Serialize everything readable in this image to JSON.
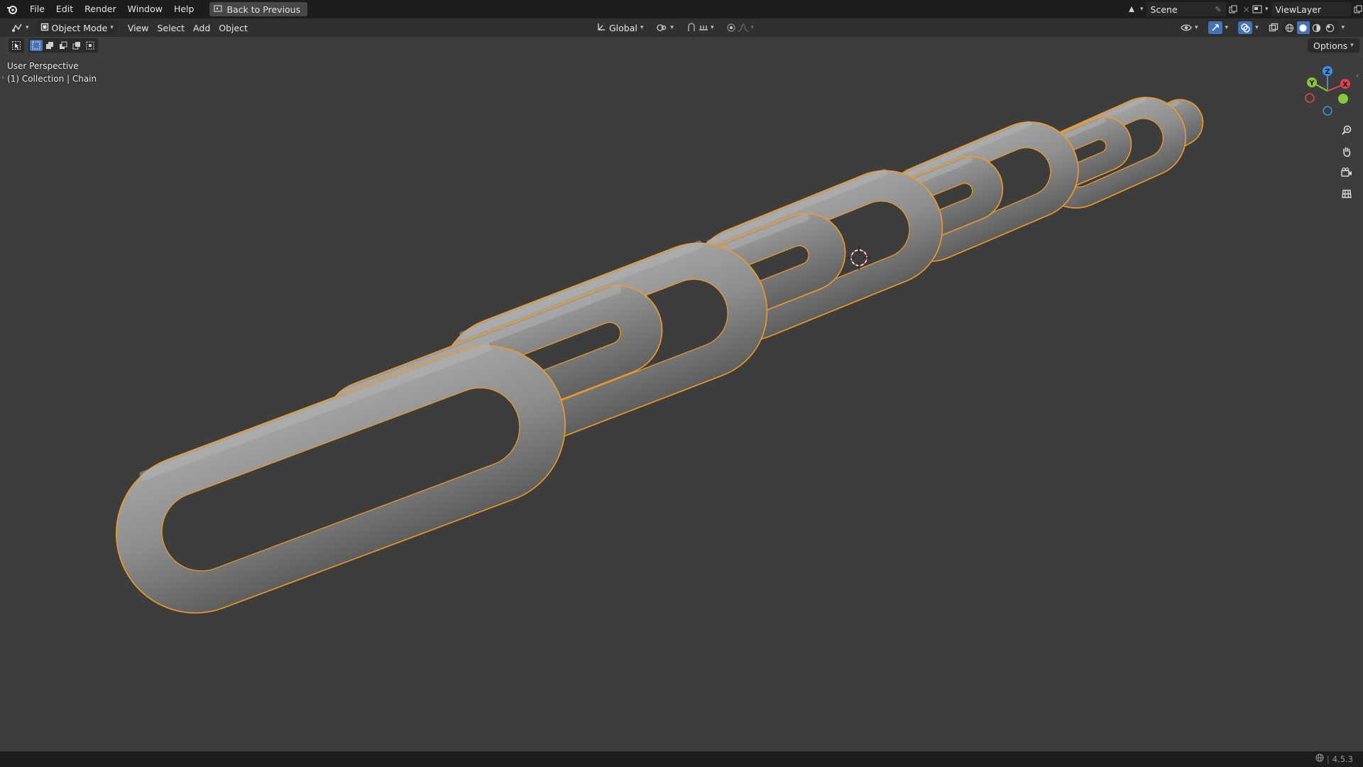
{
  "topbar": {
    "menus": [
      "File",
      "Edit",
      "Render",
      "Window",
      "Help"
    ],
    "back_label": "Back to Previous",
    "scene_name": "Scene",
    "view_layer": "ViewLayer"
  },
  "header": {
    "mode": "Object Mode",
    "menus": [
      "View",
      "Select",
      "Add",
      "Object"
    ],
    "orientation": "Global"
  },
  "viewport": {
    "perspective": "User Perspective",
    "collection": "(1) Collection | Chain",
    "options_label": "Options"
  },
  "gizmo": {
    "x_label": "X",
    "y_label": "Y",
    "z_label": "Z",
    "x_color": "#e5404f",
    "y_color": "#8bc53f",
    "z_color": "#3b8ee5"
  },
  "statusbar": {
    "version": "4.5.3"
  },
  "colors": {
    "selection_outline": "#f09a2a",
    "mesh": "#8c8c8c",
    "viewport_bg": "#3d3d3d"
  },
  "icons": [
    "blender-logo-icon",
    "back-icon",
    "editor-type-icon",
    "object-mode-icon",
    "transform-orientation-icon",
    "pivot-icon",
    "snap-icon",
    "proportional-edit-icon",
    "visibility-icon",
    "gizmo-icon",
    "overlay-icon",
    "xray-icon",
    "shading-wireframe-icon",
    "shading-solid-icon",
    "shading-material-icon",
    "shading-rendered-icon",
    "zoom-icon",
    "pan-hand-icon",
    "camera-icon",
    "grid-icon"
  ]
}
